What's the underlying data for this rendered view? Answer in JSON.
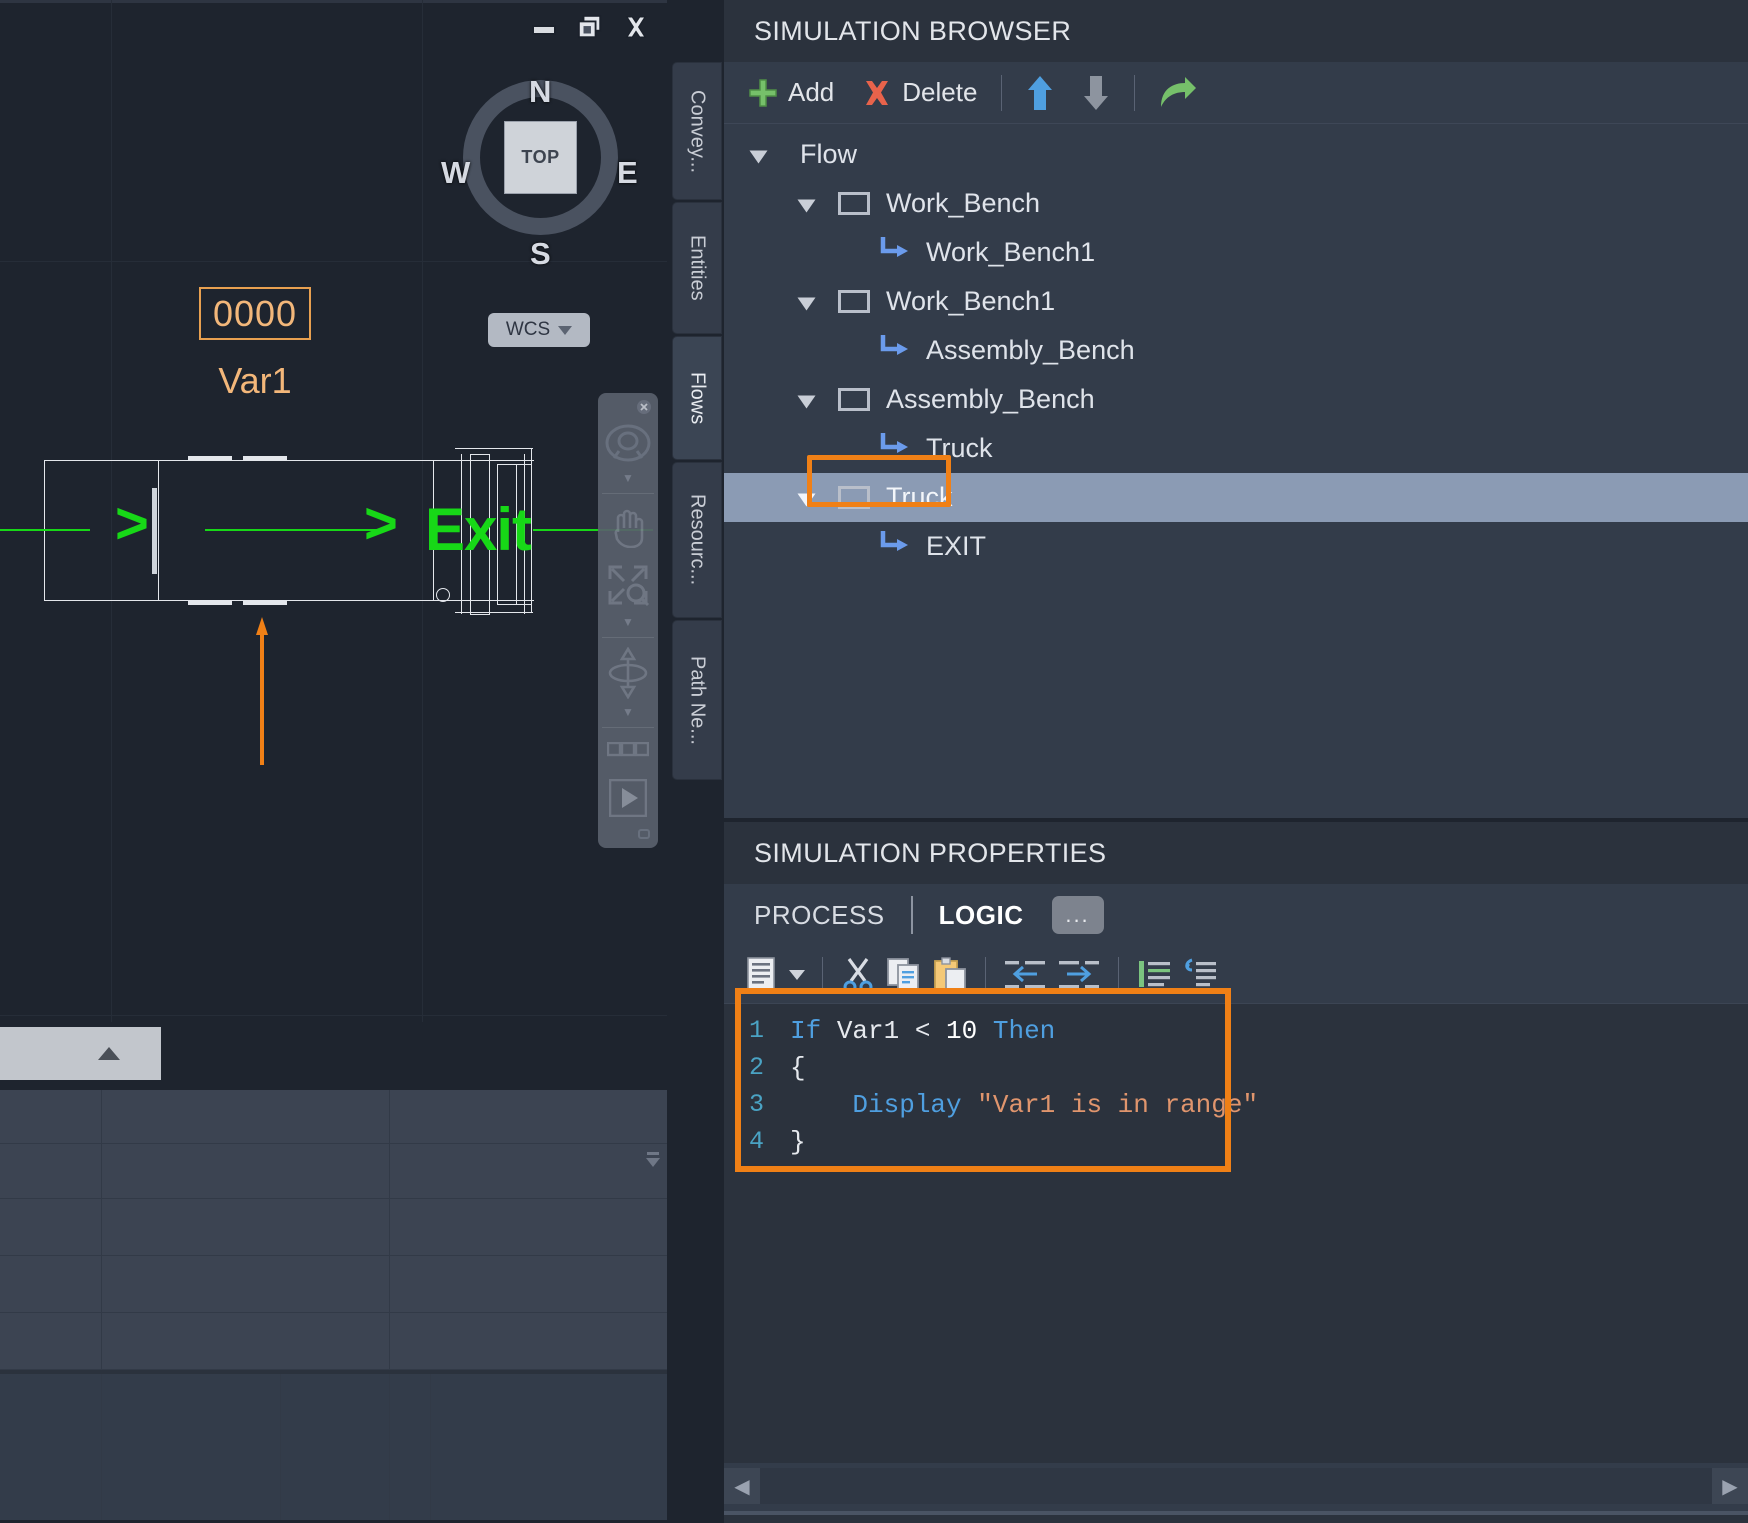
{
  "window": {
    "minimize_label": "minimize",
    "restore_label": "restore",
    "close_label": "close"
  },
  "viewport": {
    "viewcube": {
      "north": "N",
      "south": "S",
      "west": "W",
      "east": "E",
      "face": "TOP"
    },
    "wcs_label": "WCS",
    "variable_value": "0000",
    "variable_name": "Var1",
    "exit_label": "Exit",
    "chevron": ">",
    "accent_orange": "#f3b77a",
    "path_green": "#17d817"
  },
  "side_tabs": [
    {
      "label": "Convey...",
      "active": false
    },
    {
      "label": "Entities",
      "active": false
    },
    {
      "label": "Flows",
      "active": true
    },
    {
      "label": "Resourc...",
      "active": false
    },
    {
      "label": "Path Ne...",
      "active": false
    }
  ],
  "browser": {
    "title": "SIMULATION BROWSER",
    "toolbar": {
      "add_label": "Add",
      "delete_label": "Delete",
      "move_up_label": "Move Up",
      "move_down_label": "Move Down",
      "go_to_label": "Go To"
    },
    "tree": [
      {
        "label": "Flow",
        "depth": 0,
        "kind": "root",
        "expanded": true,
        "selected": false
      },
      {
        "label": "Work_Bench",
        "depth": 1,
        "kind": "node",
        "expanded": true,
        "selected": false
      },
      {
        "label": "Work_Bench1",
        "depth": 2,
        "kind": "link",
        "expanded": false,
        "selected": false
      },
      {
        "label": "Work_Bench1",
        "depth": 1,
        "kind": "node",
        "expanded": true,
        "selected": false
      },
      {
        "label": "Assembly_Bench",
        "depth": 2,
        "kind": "link",
        "expanded": false,
        "selected": false
      },
      {
        "label": "Assembly_Bench",
        "depth": 1,
        "kind": "node",
        "expanded": true,
        "selected": false
      },
      {
        "label": "Truck",
        "depth": 2,
        "kind": "link",
        "expanded": false,
        "selected": false
      },
      {
        "label": "Truck",
        "depth": 1,
        "kind": "node",
        "expanded": true,
        "selected": true
      },
      {
        "label": "EXIT",
        "depth": 2,
        "kind": "link",
        "expanded": false,
        "selected": false
      }
    ]
  },
  "properties": {
    "title": "SIMULATION PROPERTIES",
    "tabs": [
      {
        "label": "PROCESS",
        "active": false
      },
      {
        "label": "LOGIC",
        "active": true
      }
    ],
    "more_button_label": "...",
    "editor_toolbar": [
      {
        "name": "template-list-icon"
      },
      {
        "name": "dropdown-caret-icon"
      },
      {
        "name": "cut-icon"
      },
      {
        "name": "copy-icon"
      },
      {
        "name": "paste-icon"
      },
      {
        "name": "outdent-icon"
      },
      {
        "name": "indent-icon"
      },
      {
        "name": "comment-icon"
      },
      {
        "name": "uncomment-icon"
      }
    ],
    "code": {
      "line_numbers": [
        "1",
        "2",
        "3",
        "4"
      ],
      "lines": [
        [
          {
            "t": "If ",
            "c": "kw"
          },
          {
            "t": "Var1 ",
            "c": "pl"
          },
          {
            "t": "< ",
            "c": "pl"
          },
          {
            "t": "10 ",
            "c": "num"
          },
          {
            "t": "Then",
            "c": "kw"
          }
        ],
        [
          {
            "t": "{",
            "c": "pl"
          }
        ],
        [
          {
            "t": "    Display ",
            "c": "kw"
          },
          {
            "t": "\"Var1 is in range\"",
            "c": "str"
          }
        ],
        [
          {
            "t": "}",
            "c": "pl"
          }
        ]
      ]
    },
    "highlight_color": "#f08016"
  }
}
